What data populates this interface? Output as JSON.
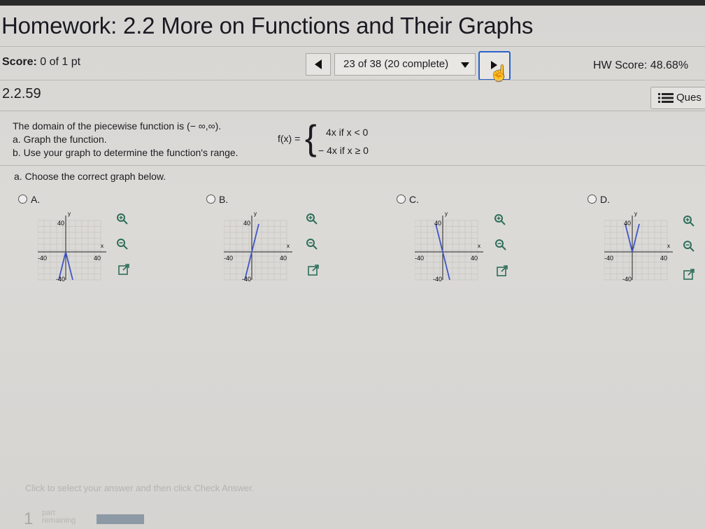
{
  "header": {
    "title": "Homework: 2.2 More on Functions and Their Graphs",
    "score_label": "Score:",
    "score_value": "0 of 1 pt",
    "nav_position": "23 of 38 (20 complete)",
    "hw_score": "HW Score: 48.68%"
  },
  "problem": {
    "number": "2.2.59",
    "question_button": "Ques",
    "line1": "The domain of the piecewise function is (− ∞,∞).",
    "line2": "a. Graph the function.",
    "line3": "b. Use your graph to determine the function's range.",
    "fx_label": "f(x) =",
    "case1": "4x  if  x < 0",
    "case2": "− 4x  if  x ≥ 0",
    "prompt": "a. Choose the correct graph below."
  },
  "options": [
    {
      "label": "A.",
      "tick_pos": "40",
      "tick_neg": "-40",
      "axis_x": "x",
      "axis_y": "y"
    },
    {
      "label": "B.",
      "tick_pos": "40",
      "tick_neg": "-40",
      "axis_x": "x",
      "axis_y": "y"
    },
    {
      "label": "C.",
      "tick_pos": "40",
      "tick_neg": "-40",
      "axis_x": "x",
      "axis_y": "y"
    },
    {
      "label": "D.",
      "tick_pos": "40",
      "tick_neg": "-40",
      "axis_x": "x",
      "axis_y": "y"
    }
  ],
  "footer": {
    "instruction": "Click to select your answer and then click Check Answer.",
    "parts_count": "1",
    "parts_label": "part remaining"
  },
  "colors": {
    "graph_line": "#3f57c8",
    "nav_focus": "#2b62c8",
    "grid": "#c7c5c2"
  },
  "icons": [
    "zoom-in-icon",
    "zoom-out-icon",
    "expand-icon",
    "list-icon",
    "cursor-icon"
  ]
}
